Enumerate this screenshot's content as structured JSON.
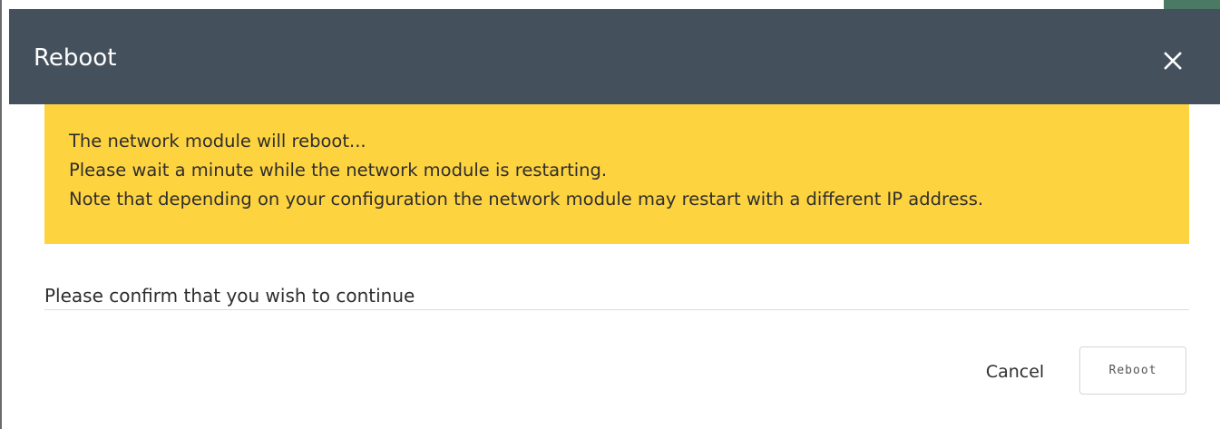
{
  "dialog": {
    "title": "Reboot",
    "close_icon": "close-icon",
    "header_color": "#44505c"
  },
  "warning": {
    "background": "#fed340",
    "lines": [
      "The network module will reboot...",
      "Please wait a minute while the network module is restarting.",
      "Note that depending on your configuration the network module may restart with a different IP address."
    ]
  },
  "confirm": {
    "text": "Please confirm that you wish to continue"
  },
  "actions": {
    "cancel_label": "Cancel",
    "reboot_label": "Reboot"
  }
}
